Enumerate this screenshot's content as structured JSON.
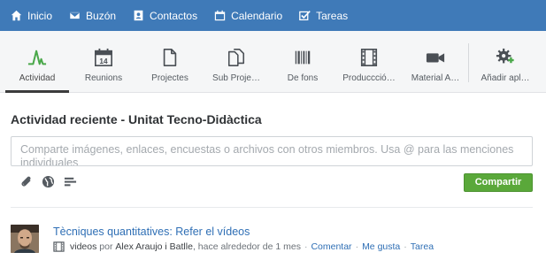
{
  "nav": {
    "items": [
      {
        "label": "Inicio",
        "icon": "home-icon"
      },
      {
        "label": "Buzón",
        "icon": "envelope-icon"
      },
      {
        "label": "Contactos",
        "icon": "contacts-icon"
      },
      {
        "label": "Calendario",
        "icon": "calendar-icon"
      },
      {
        "label": "Tareas",
        "icon": "checkbox-icon"
      }
    ],
    "bg_color": "#3f7ab8"
  },
  "tabs": {
    "items": [
      {
        "label": "Actividad",
        "icon": "activity-icon",
        "active": true
      },
      {
        "label": "Reunions",
        "icon": "calendar-day-icon",
        "day": "14"
      },
      {
        "label": "Projectes",
        "icon": "document-icon"
      },
      {
        "label": "Sub Proje…",
        "icon": "documents-icon"
      },
      {
        "label": "De fons",
        "icon": "barcode-icon"
      },
      {
        "label": "Produccció…",
        "icon": "film-icon"
      },
      {
        "label": "Material A…",
        "icon": "video-camera-icon"
      },
      {
        "label": "Añadir apl…",
        "icon": "gear-plus-icon"
      }
    ],
    "accent_activity": "#4aa84a"
  },
  "main": {
    "title": "Actividad reciente - Unitat Tecno-Didàctica",
    "composer_placeholder": "Comparte imágenes, enlaces, encuestas o archivos con otros miembros. Usa @ para las menciones individuales",
    "share_label": "Compartir",
    "share_color": "#5aa83a"
  },
  "feed": {
    "items": [
      {
        "title": "Tècniques quantitatives: Refer el vídeos",
        "type": "videos",
        "by_word": "por",
        "author": "Alex Araujo i Batlle",
        "time": ", hace alrededor de 1 mes",
        "actions": [
          "Comentar",
          "Me gusta",
          "Tarea"
        ]
      }
    ]
  }
}
